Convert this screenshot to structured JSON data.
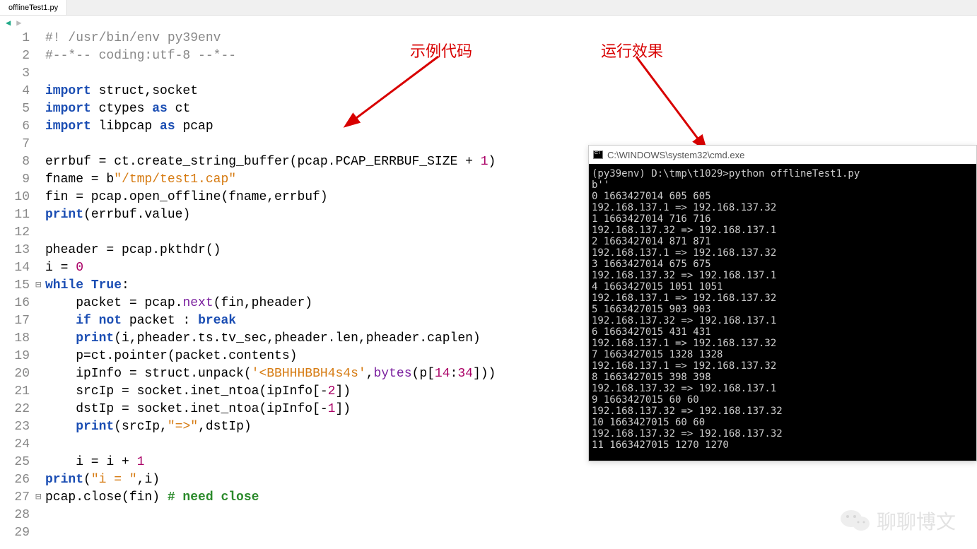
{
  "tab": {
    "label": "offlineTest1.py"
  },
  "annotations": {
    "left_label": "示例代码",
    "right_label": "运行效果"
  },
  "code": {
    "lines": [
      {
        "n": 1,
        "t": [
          [
            "c-gray",
            "#! /usr/bin/env py39env"
          ]
        ]
      },
      {
        "n": 2,
        "t": [
          [
            "c-gray",
            "#--*-- coding:utf-8 --*--"
          ]
        ]
      },
      {
        "n": 3,
        "t": [
          [
            "",
            ""
          ]
        ]
      },
      {
        "n": 4,
        "t": [
          [
            "c-blue",
            "import"
          ],
          [
            "",
            " struct,socket"
          ]
        ]
      },
      {
        "n": 5,
        "t": [
          [
            "c-blue",
            "import"
          ],
          [
            "",
            " ctypes "
          ],
          [
            "c-blue",
            "as"
          ],
          [
            "",
            " ct"
          ]
        ]
      },
      {
        "n": 6,
        "t": [
          [
            "c-blue",
            "import"
          ],
          [
            "",
            " libpcap "
          ],
          [
            "c-blue",
            "as"
          ],
          [
            "",
            " pcap"
          ]
        ]
      },
      {
        "n": 7,
        "t": [
          [
            "",
            ""
          ]
        ]
      },
      {
        "n": 8,
        "t": [
          [
            "",
            "errbuf = ct.create_string_buffer(pcap.PCAP_ERRBUF_SIZE + "
          ],
          [
            "c-num",
            "1"
          ],
          [
            "",
            ")"
          ]
        ]
      },
      {
        "n": 9,
        "t": [
          [
            "",
            "fname = b"
          ],
          [
            "c-orange",
            "\"/tmp/test1.cap\""
          ]
        ]
      },
      {
        "n": 10,
        "t": [
          [
            "",
            "fin = pcap.open_offline(fname,errbuf)"
          ]
        ]
      },
      {
        "n": 11,
        "t": [
          [
            "c-blue",
            "print"
          ],
          [
            "",
            "(errbuf.value)"
          ]
        ]
      },
      {
        "n": 12,
        "t": [
          [
            "",
            ""
          ]
        ]
      },
      {
        "n": 13,
        "t": [
          [
            "",
            "pheader = pcap.pkthdr()"
          ]
        ]
      },
      {
        "n": 14,
        "t": [
          [
            "",
            "i = "
          ],
          [
            "c-num",
            "0"
          ]
        ]
      },
      {
        "n": 15,
        "fold": true,
        "t": [
          [
            "c-blue",
            "while"
          ],
          [
            "",
            " "
          ],
          [
            "c-blue",
            "True"
          ],
          [
            "",
            ":"
          ]
        ]
      },
      {
        "n": 16,
        "t": [
          [
            "",
            "    packet = pcap."
          ],
          [
            "c-purple",
            "next"
          ],
          [
            "",
            "(fin,pheader)"
          ]
        ]
      },
      {
        "n": 17,
        "t": [
          [
            "",
            "    "
          ],
          [
            "c-blue",
            "if"
          ],
          [
            "",
            " "
          ],
          [
            "c-blue",
            "not"
          ],
          [
            "",
            " packet : "
          ],
          [
            "c-blue",
            "break"
          ]
        ]
      },
      {
        "n": 18,
        "t": [
          [
            "",
            "    "
          ],
          [
            "c-blue",
            "print"
          ],
          [
            "",
            "(i,pheader.ts.tv_sec,pheader.len,pheader.caplen)"
          ]
        ]
      },
      {
        "n": 19,
        "t": [
          [
            "",
            "    p=ct.pointer(packet.contents)"
          ]
        ]
      },
      {
        "n": 20,
        "t": [
          [
            "",
            "    ipInfo = struct.unpack("
          ],
          [
            "c-orange",
            "'<BBHHHBBH4s4s'"
          ],
          [
            "",
            ","
          ],
          [
            "c-purple",
            "bytes"
          ],
          [
            "",
            "(p["
          ],
          [
            "c-num",
            "14"
          ],
          [
            "",
            ":"
          ],
          [
            "c-num",
            "34"
          ],
          [
            "",
            "]))"
          ]
        ]
      },
      {
        "n": 21,
        "t": [
          [
            "",
            "    srcIp = socket.inet_ntoa(ipInfo[-"
          ],
          [
            "c-num",
            "2"
          ],
          [
            "",
            "])"
          ]
        ]
      },
      {
        "n": 22,
        "t": [
          [
            "",
            "    dstIp = socket.inet_ntoa(ipInfo[-"
          ],
          [
            "c-num",
            "1"
          ],
          [
            "",
            "])"
          ]
        ]
      },
      {
        "n": 23,
        "t": [
          [
            "",
            "    "
          ],
          [
            "c-blue",
            "print"
          ],
          [
            "",
            "(srcIp,"
          ],
          [
            "c-orange",
            "\"=>\""
          ],
          [
            "",
            ",dstIp)"
          ]
        ]
      },
      {
        "n": 24,
        "t": [
          [
            "",
            ""
          ]
        ]
      },
      {
        "n": 25,
        "t": [
          [
            "",
            "    i = i + "
          ],
          [
            "c-num",
            "1"
          ]
        ]
      },
      {
        "n": 26,
        "t": [
          [
            "c-blue",
            "print"
          ],
          [
            "",
            "("
          ],
          [
            "c-orange",
            "\"i = \""
          ],
          [
            "",
            ",i)"
          ]
        ]
      },
      {
        "n": 27,
        "fold": true,
        "t": [
          [
            "",
            "pcap.close(fin) "
          ],
          [
            "c-green",
            "# need close"
          ]
        ]
      },
      {
        "n": 28,
        "t": [
          [
            "",
            ""
          ]
        ]
      },
      {
        "n": 29,
        "t": [
          [
            "",
            ""
          ]
        ]
      }
    ]
  },
  "cmd": {
    "title": "C:\\WINDOWS\\system32\\cmd.exe",
    "output": "(py39env) D:\\tmp\\t1029>python offlineTest1.py\nb''\n0 1663427014 605 605\n192.168.137.1 => 192.168.137.32\n1 1663427014 716 716\n192.168.137.32 => 192.168.137.1\n2 1663427014 871 871\n192.168.137.1 => 192.168.137.32\n3 1663427014 675 675\n192.168.137.32 => 192.168.137.1\n4 1663427015 1051 1051\n192.168.137.1 => 192.168.137.32\n5 1663427015 903 903\n192.168.137.32 => 192.168.137.1\n6 1663427015 431 431\n192.168.137.1 => 192.168.137.32\n7 1663427015 1328 1328\n192.168.137.1 => 192.168.137.32\n8 1663427015 398 398\n192.168.137.32 => 192.168.137.1\n9 1663427015 60 60\n192.168.137.32 => 192.168.137.32\n10 1663427015 60 60\n192.168.137.32 => 192.168.137.32\n11 1663427015 1270 1270"
  },
  "watermark": {
    "text": "聊聊博文"
  }
}
